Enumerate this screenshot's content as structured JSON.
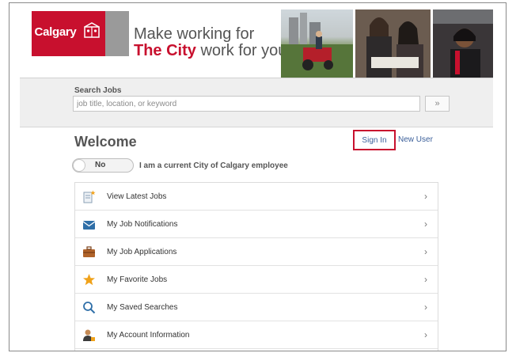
{
  "banner": {
    "logo_text": "Calgary",
    "tagline_line1": "Make working for",
    "tagline_line2_red": "The City",
    "tagline_line2_rest": " work for you."
  },
  "search": {
    "label": "Search Jobs",
    "placeholder": "job title, location, or keyword",
    "button": "»"
  },
  "welcome": {
    "title": "Welcome",
    "sign_in": "Sign In",
    "new_user": "New User",
    "toggle_value": "No",
    "employee_text": "I am a current City of Calgary employee"
  },
  "menu": {
    "items": [
      {
        "label": "View Latest Jobs",
        "icon": "document-star-icon",
        "chevron": "›"
      },
      {
        "label": "My Job Notifications",
        "icon": "envelope-icon",
        "chevron": "›"
      },
      {
        "label": "My Job Applications",
        "icon": "briefcase-icon",
        "chevron": "›"
      },
      {
        "label": "My Favorite Jobs",
        "icon": "star-icon",
        "chevron": "›"
      },
      {
        "label": "My Saved Searches",
        "icon": "search-icon",
        "chevron": "›"
      },
      {
        "label": "My Account Information",
        "icon": "user-icon",
        "chevron": "›"
      }
    ]
  }
}
